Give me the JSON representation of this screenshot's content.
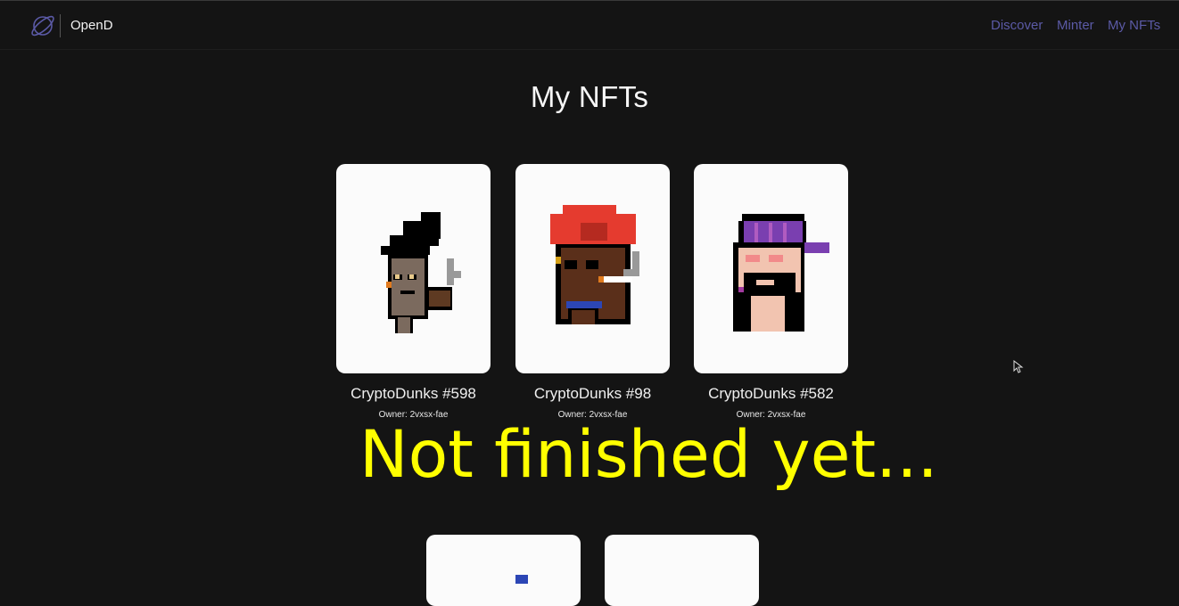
{
  "app": {
    "brand": "OpenD",
    "logo_icon": "planet-icon"
  },
  "nav": {
    "items": [
      {
        "label": "Discover"
      },
      {
        "label": "Minter"
      },
      {
        "label": "My NFTs"
      }
    ]
  },
  "main": {
    "title": "My NFTs",
    "nfts": [
      {
        "name": "CryptoDunks #598",
        "owner": "Owner: 2vxsx-fae"
      },
      {
        "name": "CryptoDunks #98",
        "owner": "Owner: 2vxsx-fae"
      },
      {
        "name": "CryptoDunks #582",
        "owner": "Owner: 2vxsx-fae"
      }
    ]
  },
  "overlay": {
    "text": "Not finished yet..."
  },
  "colors": {
    "background": "#141414",
    "nav_link": "#5b5aa6",
    "overlay": "#ffff00",
    "card": "#fbfbfb"
  }
}
